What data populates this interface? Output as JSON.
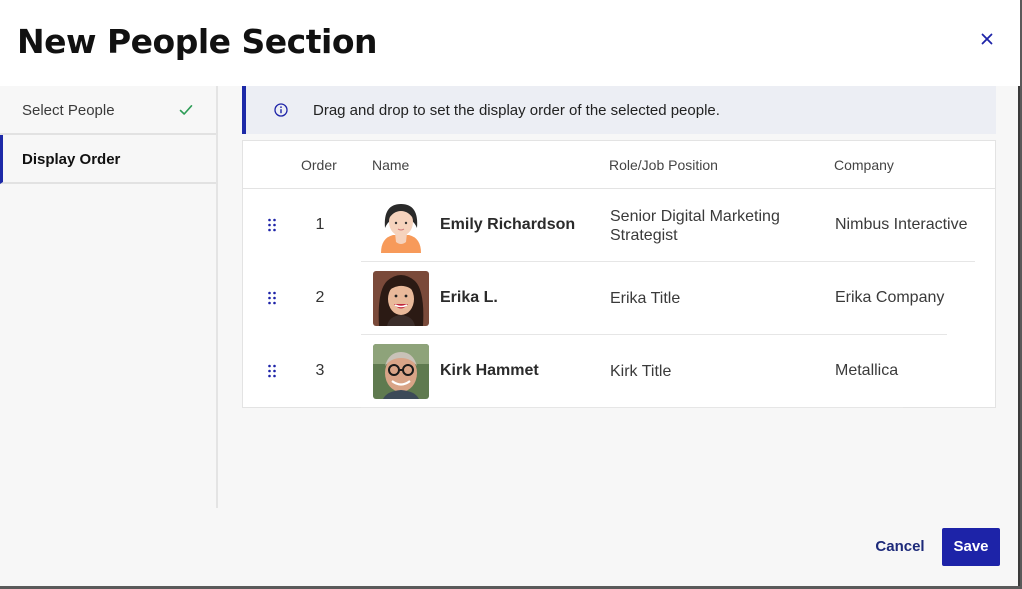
{
  "dialog": {
    "title": "New People Section"
  },
  "sidebar": {
    "items": [
      {
        "label": "Select People",
        "completed": true
      },
      {
        "label": "Display Order",
        "active": true
      }
    ]
  },
  "info": {
    "text": "Drag and drop to set the display order of the selected people."
  },
  "table": {
    "headers": {
      "order": "Order",
      "name": "Name",
      "role": "Role/Job Position",
      "company": "Company"
    },
    "rows": [
      {
        "order": "1",
        "name": "Emily Richardson",
        "role": "Senior Digital Marketing Strategist",
        "company": "Nimbus Interactive",
        "avatar": "illustrated-woman-avatar"
      },
      {
        "order": "2",
        "name": "Erika L.",
        "role": "Erika Title",
        "company": "Erika Company",
        "avatar": "photo-woman-smiling"
      },
      {
        "order": "3",
        "name": "Kirk Hammet",
        "role": "Kirk Title",
        "company": "Metallica",
        "avatar": "photo-man-glasses"
      }
    ]
  },
  "footer": {
    "cancel_label": "Cancel",
    "save_label": "Save"
  },
  "colors": {
    "accent": "#1d23a8",
    "check": "#2e9d57",
    "info_bg": "#eceef4"
  }
}
